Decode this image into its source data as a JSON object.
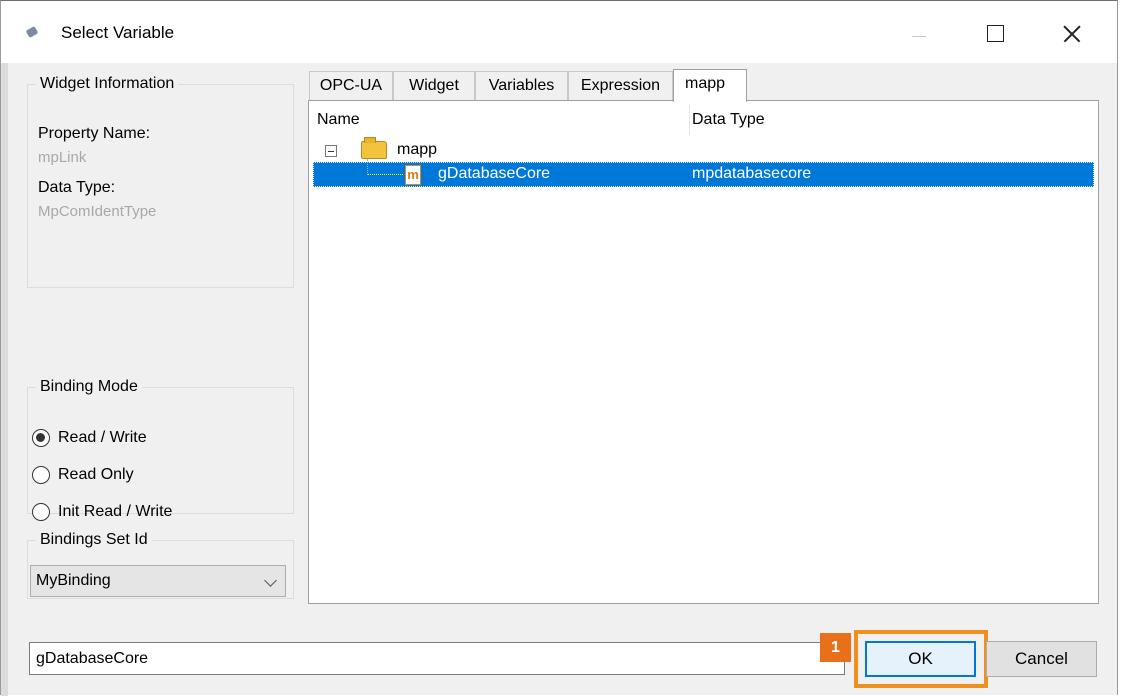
{
  "window": {
    "title": "Select Variable"
  },
  "widget_info": {
    "legend": "Widget Information",
    "property_label": "Property Name:",
    "property_value": "mpLink",
    "type_label": "Data Type:",
    "type_value": "MpComIdentType"
  },
  "binding_mode": {
    "legend": "Binding Mode",
    "options": [
      {
        "label": "Read / Write",
        "checked": true
      },
      {
        "label": "Read Only",
        "checked": false
      },
      {
        "label": "Init Read / Write",
        "checked": false
      }
    ]
  },
  "bindings_set": {
    "legend": "Bindings Set Id",
    "selected": "MyBinding"
  },
  "tabs": [
    {
      "label": "OPC-UA",
      "active": false
    },
    {
      "label": "Widget",
      "active": false
    },
    {
      "label": "Variables",
      "active": false
    },
    {
      "label": "Expression",
      "active": false
    },
    {
      "label": "mapp",
      "active": true
    }
  ],
  "tree": {
    "columns": [
      "Name",
      "Data Type"
    ],
    "root": {
      "label": "mapp",
      "icon": "folder-icon",
      "expanded": true
    },
    "children": [
      {
        "name": "gDatabaseCore",
        "type": "mpdatabasecore",
        "icon": "mapp-variable-icon",
        "selected": true
      }
    ]
  },
  "footer": {
    "path_value": "gDatabaseCore",
    "badge": "1",
    "ok_label": "OK",
    "cancel_label": "Cancel"
  },
  "colors": {
    "selection": "#0078d7",
    "highlight": "#ef8f1f",
    "badge": "#e8701b"
  }
}
